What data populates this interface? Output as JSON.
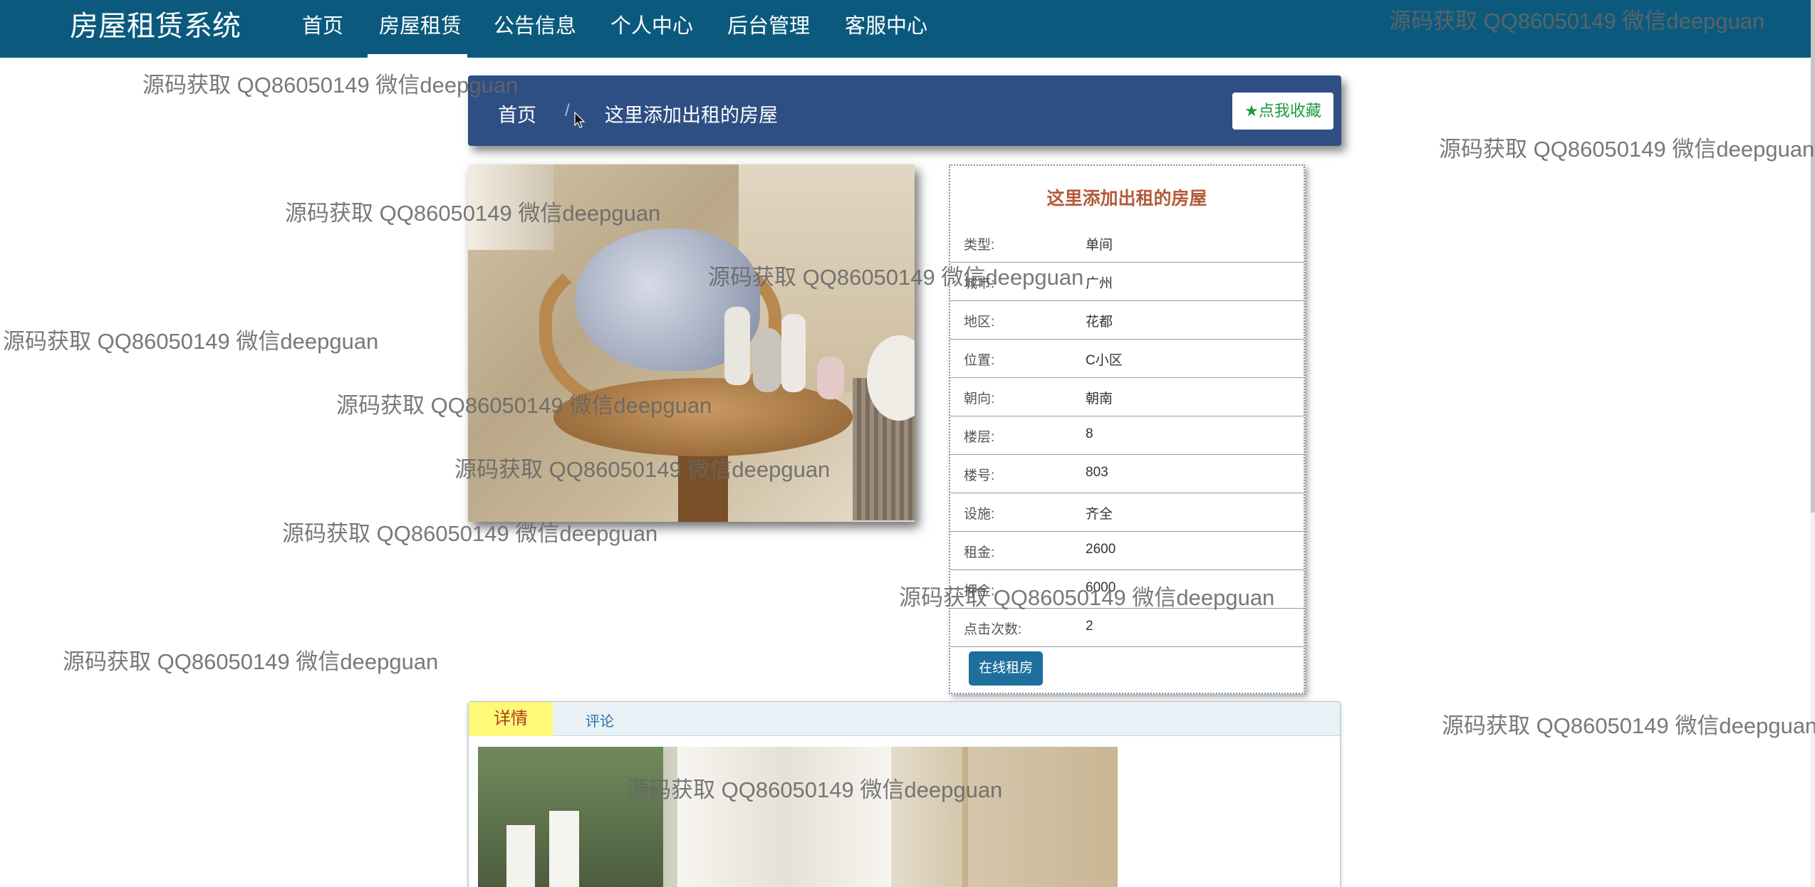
{
  "brand": "房屋租赁系统",
  "nav": [
    {
      "label": "首页"
    },
    {
      "label": "房屋租赁"
    },
    {
      "label": "公告信息"
    },
    {
      "label": "个人中心"
    },
    {
      "label": "后台管理"
    },
    {
      "label": "客服中心"
    }
  ],
  "nav_active": "房屋租赁",
  "breadcrumb": {
    "home": "首页",
    "separator": "/",
    "current": "这里添加出租的房屋"
  },
  "favorite_button": {
    "icon": "star-icon",
    "label": "点我收藏"
  },
  "house": {
    "title": "这里添加出租的房屋",
    "rows": [
      {
        "label": "类型:",
        "value": "单间"
      },
      {
        "label": "城市:",
        "value": "广州"
      },
      {
        "label": "地区:",
        "value": "花都"
      },
      {
        "label": "位置:",
        "value": "C小区"
      },
      {
        "label": "朝向:",
        "value": "朝南"
      },
      {
        "label": "楼层:",
        "value": "8"
      },
      {
        "label": "楼号:",
        "value": "803"
      },
      {
        "label": "设施:",
        "value": "齐全"
      },
      {
        "label": "租金:",
        "value": "2600"
      },
      {
        "label": "押金:",
        "value": "6000"
      },
      {
        "label": "点击次数:",
        "value": "2"
      }
    ],
    "rent_button": "在线租房"
  },
  "tabs": {
    "detail": "详情",
    "comment": "评论"
  },
  "watermark": "源码获取 QQ86050149 微信deepguan",
  "colors": {
    "nav_bg": "#0b5a7e",
    "crumb_bg": "#2e4f83",
    "title": "#b35a3a",
    "button": "#1e6f9d",
    "tab_active": "#fff97a"
  }
}
